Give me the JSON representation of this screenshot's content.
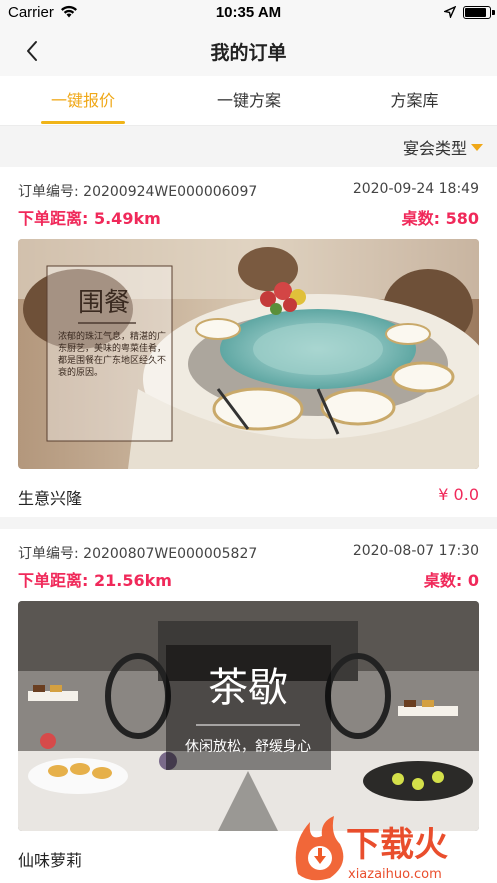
{
  "status": {
    "carrier": "Carrier",
    "time": "10:35 AM",
    "battery_level": 0.9
  },
  "nav": {
    "title": "我的订单",
    "back_icon": "chevron-left-icon"
  },
  "tabs": [
    {
      "label": "一键报价",
      "active": true
    },
    {
      "label": "一键方案",
      "active": false
    },
    {
      "label": "方案库",
      "active": false
    }
  ],
  "filter": {
    "label": "宴会类型"
  },
  "orders": [
    {
      "order_no": "订单编号: 20200924WE000006097",
      "date": "2020-09-24 18:49",
      "distance": "下单距离: 5.49km",
      "tables": "桌数: 580",
      "image": {
        "heading": "围餐",
        "body": "浓郁的珠江气息，精湛的广东厨艺，美味的粤菜佳肴，都是围餐在广东地区经久不衰的原因。"
      },
      "name": "生意兴隆",
      "price": "¥ 0.0"
    },
    {
      "order_no": "订单编号: 20200807WE000005827",
      "date": "2020-08-07 17:30",
      "distance": "下单距离: 21.56km",
      "tables": "桌数: 0",
      "image": {
        "heading": "茶歇",
        "subheading": "休闲放松，舒缓身心"
      },
      "name": "仙味萝莉",
      "price": ""
    }
  ],
  "watermark": {
    "text": "下载火",
    "url_text": "xiazaihuo.com"
  },
  "colors": {
    "accent": "#f0a818",
    "price_red": "#f0295a"
  }
}
